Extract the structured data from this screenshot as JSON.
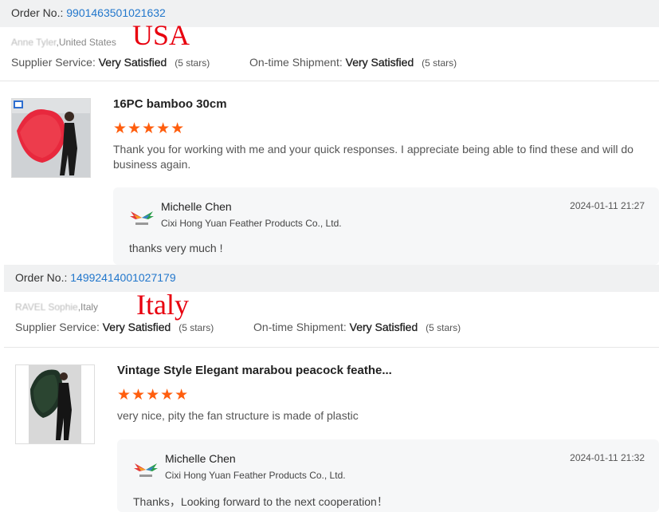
{
  "reviews": [
    {
      "order_label": "Order No.:",
      "order_no": "9901463501021632",
      "buyer_name": "Anne Tyler",
      "buyer_country": ",United States",
      "country_tag": "USA",
      "supplier_service_label": "Supplier Service:",
      "supplier_service_value": "Very Satisfied",
      "supplier_service_stars": "(5 stars)",
      "shipment_label": "On-time Shipment:",
      "shipment_value": "Very Satisfied",
      "shipment_stars": "(5 stars)",
      "product_title": "16PC bamboo 30cm",
      "rating": 5,
      "stars": "★★★★★",
      "comment": "Thank you for working with me and your quick responses.  I appreciate being able to find these and will do business again.",
      "reply": {
        "seller": "Michelle Chen",
        "company": "Cixi Hong Yuan Feather Products Co., Ltd.",
        "date": "2024-01-11 21:27",
        "message": "thanks very much !"
      }
    },
    {
      "order_label": "Order No.:",
      "order_no": "14992414001027179",
      "buyer_name": "RAVEL Sophie",
      "buyer_country": ",Italy",
      "country_tag": "Italy",
      "supplier_service_label": "Supplier Service:",
      "supplier_service_value": "Very Satisfied",
      "supplier_service_stars": "(5 stars)",
      "shipment_label": "On-time Shipment:",
      "shipment_value": "Very Satisfied",
      "shipment_stars": "(5 stars)",
      "product_title": "Vintage Style Elegant marabou peacock feathe...",
      "rating": 5,
      "stars": "★★★★★",
      "comment": "very nice, pity the fan structure is made of plastic",
      "reply": {
        "seller": "Michelle Chen",
        "company": "Cixi Hong Yuan Feather Products Co., Ltd.",
        "date": "2024-01-11 21:32",
        "message": "Thanks，Looking forward to the next cooperation！"
      }
    }
  ],
  "colors": {
    "order_link": "#2277cc",
    "stars": "#ff5e0e",
    "country_tag": "#e8000e",
    "order_bar": "#f0f1f2",
    "reply_bg": "#f6f7f8"
  },
  "icons": {
    "seller_logo": "feather-wings-logo",
    "product_1": "red-feather-fan-photo",
    "product_2": "peacock-feather-fan-photo"
  }
}
